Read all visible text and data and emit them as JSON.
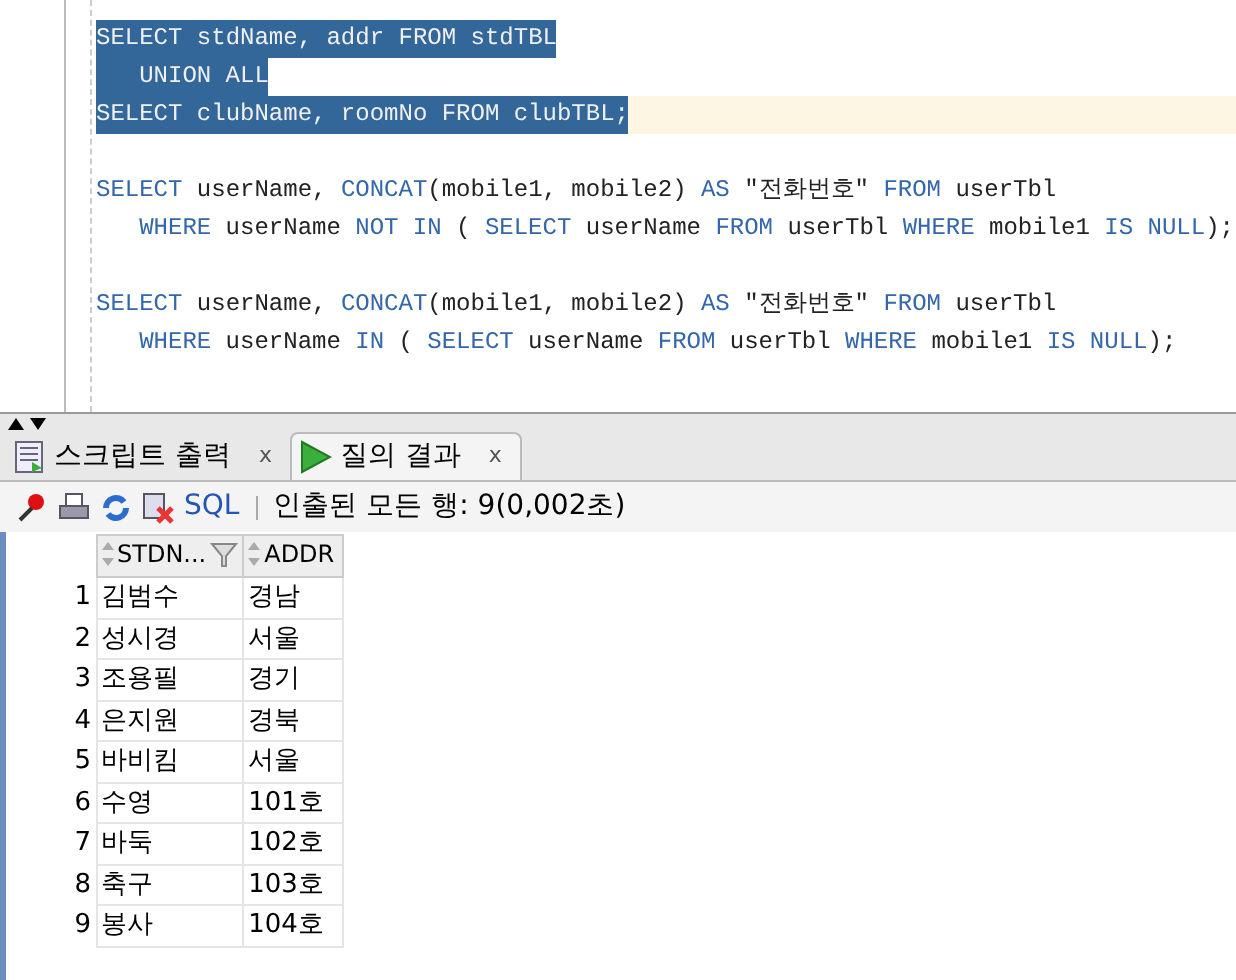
{
  "editor": {
    "blocks": [
      {
        "lines": [
          {
            "selected": true,
            "current": false,
            "tokens": [
              {
                "kind": "kw",
                "text": "SELECT"
              },
              {
                "kind": "text",
                "text": " stdName, addr "
              },
              {
                "kind": "kw",
                "text": "FROM"
              },
              {
                "kind": "text",
                "text": " stdTBL"
              }
            ]
          },
          {
            "selected": true,
            "current": false,
            "tokens": [
              {
                "kind": "kw",
                "text": "   UNION ALL"
              }
            ]
          },
          {
            "selected": true,
            "current": true,
            "tokens": [
              {
                "kind": "kw",
                "text": "SELECT"
              },
              {
                "kind": "text",
                "text": " clubName, roomNo "
              },
              {
                "kind": "kw",
                "text": "FROM"
              },
              {
                "kind": "text",
                "text": " clubTBL;"
              }
            ]
          }
        ]
      },
      {
        "lines": [
          {
            "selected": false,
            "current": false,
            "tokens": [
              {
                "kind": "kw",
                "text": "SELECT"
              },
              {
                "kind": "text",
                "text": " userName, "
              },
              {
                "kind": "kw",
                "text": "CONCAT"
              },
              {
                "kind": "text",
                "text": "(mobile1, mobile2) "
              },
              {
                "kind": "kw",
                "text": "AS"
              },
              {
                "kind": "text",
                "text": " \"전화번호\" "
              },
              {
                "kind": "kw",
                "text": "FROM"
              },
              {
                "kind": "text",
                "text": " userTbl"
              }
            ]
          },
          {
            "selected": false,
            "current": false,
            "tokens": [
              {
                "kind": "kw",
                "text": "   WHERE"
              },
              {
                "kind": "text",
                "text": " userName "
              },
              {
                "kind": "kw",
                "text": "NOT IN"
              },
              {
                "kind": "text",
                "text": " ( "
              },
              {
                "kind": "kw",
                "text": "SELECT"
              },
              {
                "kind": "text",
                "text": " userName "
              },
              {
                "kind": "kw",
                "text": "FROM"
              },
              {
                "kind": "text",
                "text": " userTbl "
              },
              {
                "kind": "kw",
                "text": "WHERE"
              },
              {
                "kind": "text",
                "text": " mobile1 "
              },
              {
                "kind": "kw",
                "text": "IS NULL"
              },
              {
                "kind": "text",
                "text": ");"
              }
            ]
          }
        ]
      },
      {
        "lines": [
          {
            "selected": false,
            "current": false,
            "tokens": [
              {
                "kind": "kw",
                "text": "SELECT"
              },
              {
                "kind": "text",
                "text": " userName, "
              },
              {
                "kind": "kw",
                "text": "CONCAT"
              },
              {
                "kind": "text",
                "text": "(mobile1, mobile2) "
              },
              {
                "kind": "kw",
                "text": "AS"
              },
              {
                "kind": "text",
                "text": " \"전화번호\" "
              },
              {
                "kind": "kw",
                "text": "FROM"
              },
              {
                "kind": "text",
                "text": " userTbl"
              }
            ]
          },
          {
            "selected": false,
            "current": false,
            "tokens": [
              {
                "kind": "kw",
                "text": "   WHERE"
              },
              {
                "kind": "text",
                "text": " userName "
              },
              {
                "kind": "kw",
                "text": "IN"
              },
              {
                "kind": "text",
                "text": " ( "
              },
              {
                "kind": "kw",
                "text": "SELECT"
              },
              {
                "kind": "text",
                "text": " userName "
              },
              {
                "kind": "kw",
                "text": "FROM"
              },
              {
                "kind": "text",
                "text": " userTbl "
              },
              {
                "kind": "kw",
                "text": "WHERE"
              },
              {
                "kind": "text",
                "text": " mobile1 "
              },
              {
                "kind": "kw",
                "text": "IS NULL"
              },
              {
                "kind": "text",
                "text": ");"
              }
            ]
          }
        ]
      }
    ]
  },
  "tabs": [
    {
      "label": "스크립트 출력",
      "close": "x",
      "selected": false
    },
    {
      "label": "질의 결과",
      "close": "x",
      "selected": true
    }
  ],
  "toolbar": {
    "sql": "SQL",
    "status": "인출된 모든 행: 9(0,002초)"
  },
  "table": {
    "columns": [
      "",
      "STDN...",
      "ADDR"
    ],
    "rows": [
      [
        "1",
        "김범수",
        "경남"
      ],
      [
        "2",
        "성시경",
        "서울"
      ],
      [
        "3",
        "조용필",
        "경기"
      ],
      [
        "4",
        "은지원",
        "경북"
      ],
      [
        "5",
        "바비킴",
        "서울"
      ],
      [
        "6",
        "수영",
        "101호"
      ],
      [
        "7",
        "바둑",
        "102호"
      ],
      [
        "8",
        "축구",
        "103호"
      ],
      [
        "9",
        "봉사",
        "104호"
      ]
    ]
  }
}
